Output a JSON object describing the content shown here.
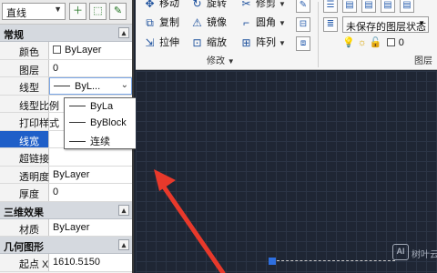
{
  "palette": {
    "object_combo": "直线",
    "sections": {
      "general": "常规",
      "3d_effects": "三维效果",
      "geometry": "几何图形"
    },
    "general_rows": [
      {
        "label": "颜色",
        "value": "ByLayer"
      },
      {
        "label": "图层",
        "value": "0"
      },
      {
        "label": "线型",
        "value": "ByL..."
      },
      {
        "label": "线型比例",
        "value": ""
      },
      {
        "label": "打印样式",
        "value": ""
      },
      {
        "label": "线宽",
        "value": ""
      },
      {
        "label": "超链接",
        "value": ""
      },
      {
        "label": "透明度",
        "value": "ByLayer"
      },
      {
        "label": "厚度",
        "value": "0"
      }
    ],
    "material_row": {
      "label": "材质",
      "value": "ByLayer"
    },
    "geometry_row": {
      "label": "起点 X",
      "value": "1610.5150"
    },
    "linetype_dropdown": [
      "ByLa",
      "ByBlock",
      "连续"
    ]
  },
  "ribbon": {
    "modify_buttons": [
      {
        "label": "移动",
        "icon": "move-icon"
      },
      {
        "label": "旋转",
        "icon": "rotate-icon"
      },
      {
        "label": "修剪",
        "icon": "trim-icon"
      },
      {
        "label": "复制",
        "icon": "copy-icon"
      },
      {
        "label": "镜像",
        "icon": "mirror-icon"
      },
      {
        "label": "圆角",
        "icon": "fillet-icon"
      },
      {
        "label": "拉伸",
        "icon": "stretch-icon"
      },
      {
        "label": "缩放",
        "icon": "scale-icon"
      },
      {
        "label": "阵列",
        "icon": "array-icon"
      }
    ],
    "modify_panel_title": "修改",
    "layer_state": "未保存的图层状态",
    "layer_value": "0",
    "layers_panel_title": "图层"
  },
  "watermark": {
    "logo": "AI",
    "text": "树叶云"
  },
  "colors": {
    "accent": "#1f5fc8",
    "canvas": "#1f2634",
    "arrow": "#e8392b",
    "grip": "#2e6fe0"
  }
}
